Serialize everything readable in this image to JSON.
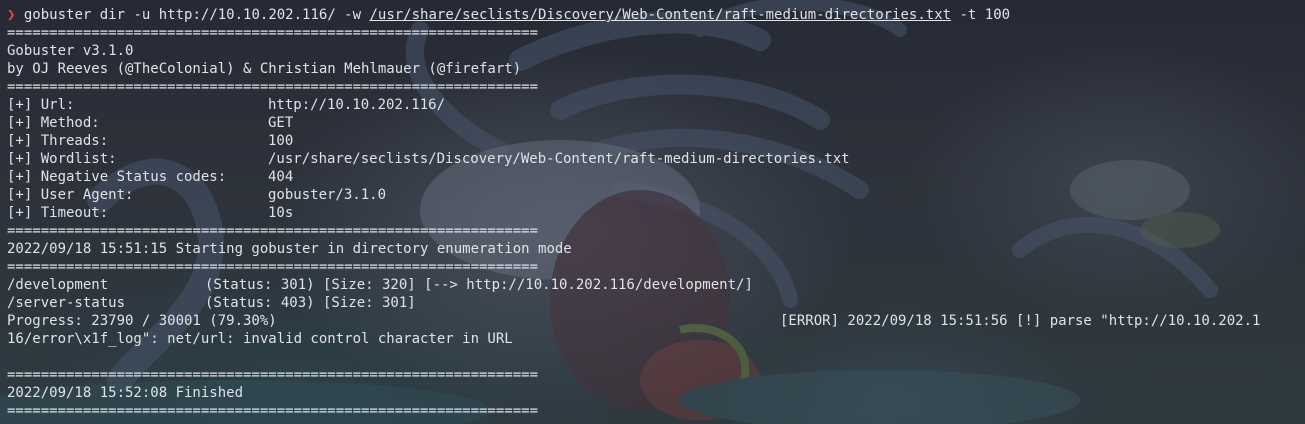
{
  "command": {
    "prompt": "❯",
    "program": "gobuster",
    "args_before": " dir -u http://10.10.202.116/ -w ",
    "wordlist_path": "/usr/share/seclists/Discovery/Web-Content/raft-medium-directories.txt",
    "args_after": " -t 100"
  },
  "separator": "===============================================================",
  "banner": {
    "version": "Gobuster v3.1.0",
    "authors": "by OJ Reeves (@TheColonial) & Christian Mehlmauer (@firefart)"
  },
  "config": [
    {
      "key": "[+] Url:",
      "value": "http://10.10.202.116/"
    },
    {
      "key": "[+] Method:",
      "value": "GET"
    },
    {
      "key": "[+] Threads:",
      "value": "100"
    },
    {
      "key": "[+] Wordlist:",
      "value": "/usr/share/seclists/Discovery/Web-Content/raft-medium-directories.txt"
    },
    {
      "key": "[+] Negative Status codes:",
      "value": "404"
    },
    {
      "key": "[+] User Agent:",
      "value": "gobuster/3.1.0"
    },
    {
      "key": "[+] Timeout:",
      "value": "10s"
    }
  ],
  "start_line": "2022/09/18 15:51:15 Starting gobuster in directory enumeration mode",
  "results": [
    {
      "path": "/development",
      "info": "(Status: 301) [Size: 320] [--> http://10.10.202.116/development/]"
    },
    {
      "path": "/server-status",
      "info": "(Status: 403) [Size: 301]"
    }
  ],
  "progress": "Progress: 23790 / 30001 (79.30%)",
  "error_part1": "[ERROR] 2022/09/18 15:51:56 [!] parse \"http://10.10.202.1",
  "error_part2": "16/error\\x1f_log\": net/url: invalid control character in URL",
  "finished_line": "2022/09/18 15:52:08 Finished",
  "wallpaper_colors": {
    "tentacle": "#46536a",
    "creature": "#5a6272",
    "accent_red": "#8a3a3a",
    "accent_green": "#6a8a3a"
  }
}
